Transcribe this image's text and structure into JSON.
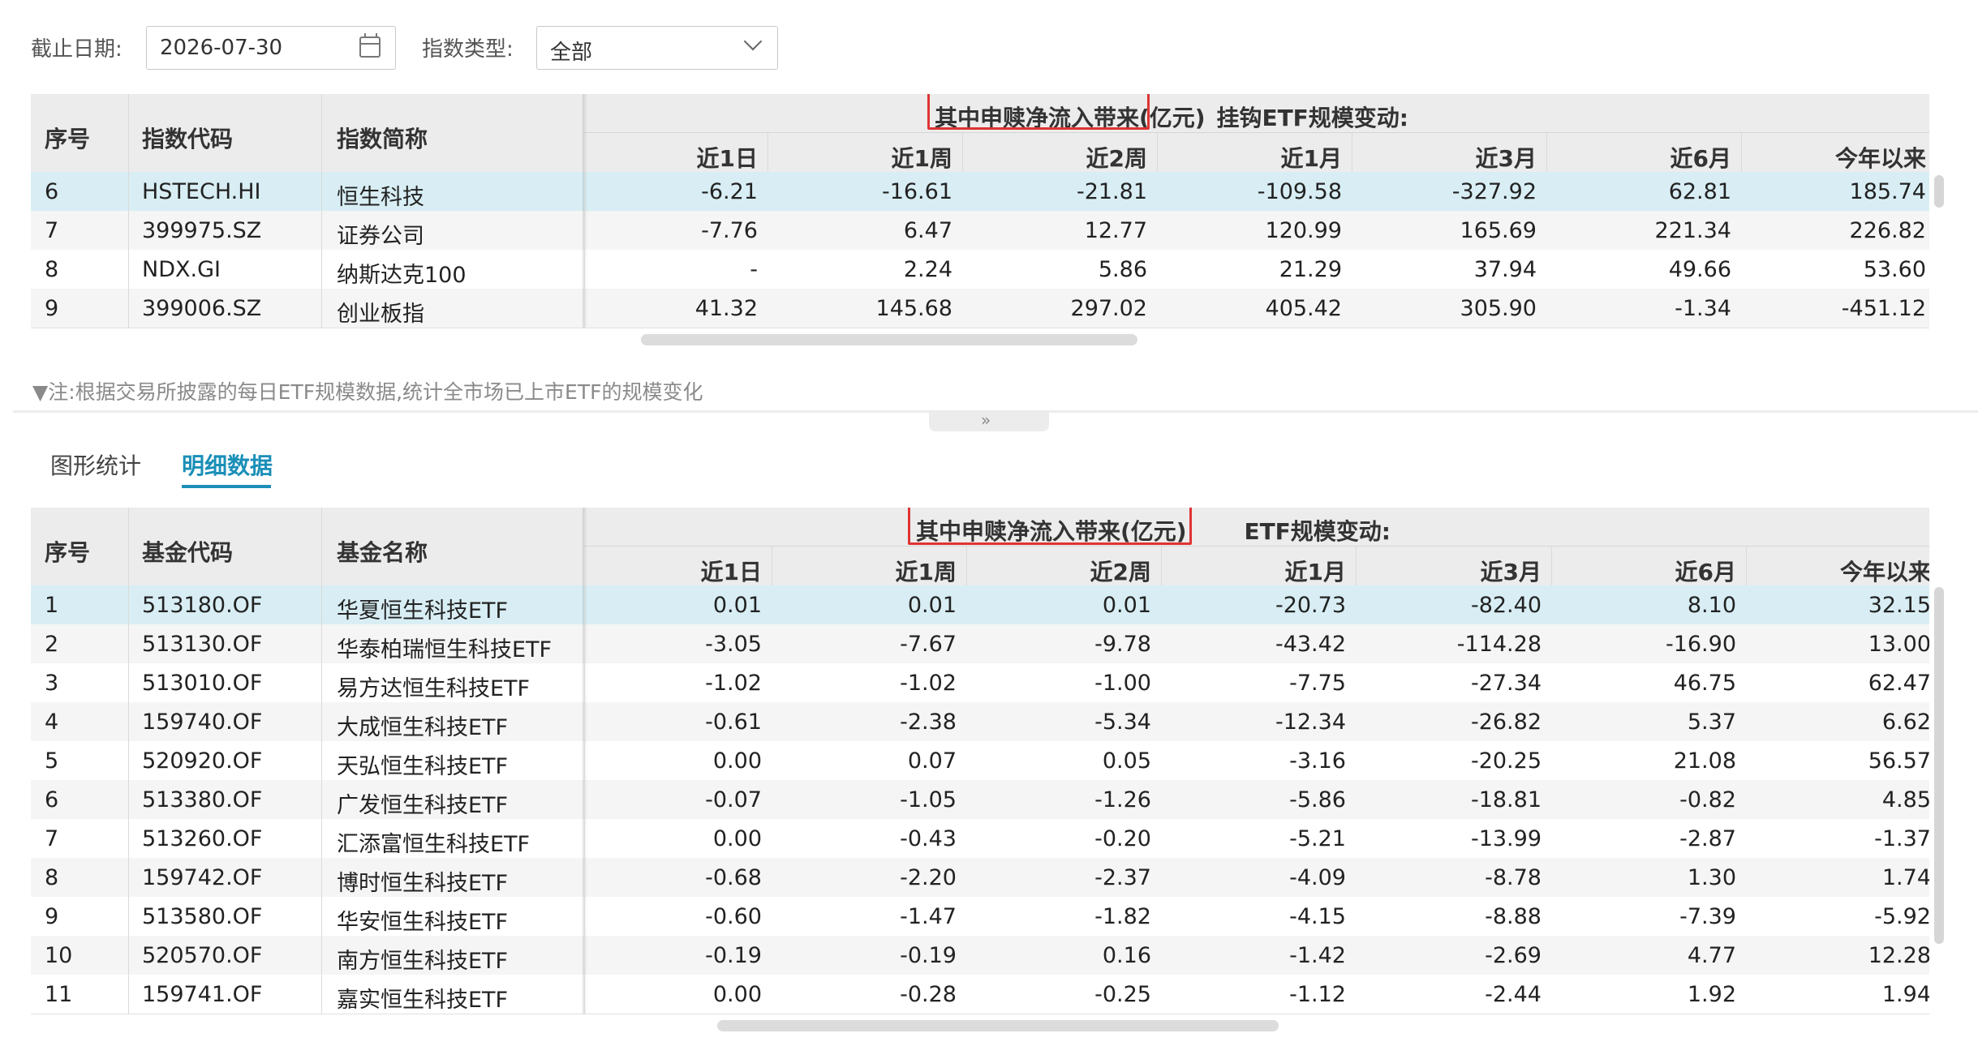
{
  "filters": {
    "date_label": "截止日期:",
    "date_value": "2026-07-30",
    "type_label": "指数类型:",
    "type_value": "全部"
  },
  "index_table": {
    "group_prefix": "挂钩ETF规模变动:",
    "group_highlight": "其中申赎净流入带来(亿元)",
    "fixed_headers": [
      "序号",
      "指数代码",
      "指数简称"
    ],
    "period_headers": [
      "近1日",
      "近1周",
      "近2周",
      "近1月",
      "近3月",
      "近6月",
      "今年以来"
    ],
    "rows": [
      {
        "no": "6",
        "code": "HSTECH.HI",
        "name": "恒生科技",
        "v": [
          "-6.21",
          "-16.61",
          "-21.81",
          "-109.58",
          "-327.92",
          "62.81",
          "185.74"
        ]
      },
      {
        "no": "7",
        "code": "399975.SZ",
        "name": "证券公司",
        "v": [
          "-7.76",
          "6.47",
          "12.77",
          "120.99",
          "165.69",
          "221.34",
          "226.82"
        ]
      },
      {
        "no": "8",
        "code": "NDX.GI",
        "name": "纳斯达克100",
        "v": [
          "-",
          "2.24",
          "5.86",
          "21.29",
          "37.94",
          "49.66",
          "53.60"
        ]
      },
      {
        "no": "9",
        "code": "399006.SZ",
        "name": "创业板指",
        "v": [
          "41.32",
          "145.68",
          "297.02",
          "405.42",
          "305.90",
          "-1.34",
          "-451.12"
        ]
      }
    ]
  },
  "note": "▼注:根据交易所披露的每日ETF规模数据,统计全市场已上市ETF的规模变化",
  "tabs": [
    "图形统计",
    "明细数据"
  ],
  "fund_table": {
    "group_prefix": "ETF规模变动:",
    "group_highlight": "其中申赎净流入带来(亿元)",
    "fixed_headers": [
      "序号",
      "基金代码",
      "基金名称"
    ],
    "period_headers": [
      "近1日",
      "近1周",
      "近2周",
      "近1月",
      "近3月",
      "近6月",
      "今年以来"
    ],
    "rows": [
      {
        "no": "1",
        "code": "513180.OF",
        "name": "华夏恒生科技ETF",
        "v": [
          "0.01",
          "0.01",
          "0.01",
          "-20.73",
          "-82.40",
          "8.10",
          "32.15"
        ]
      },
      {
        "no": "2",
        "code": "513130.OF",
        "name": "华泰柏瑞恒生科技ETF",
        "v": [
          "-3.05",
          "-7.67",
          "-9.78",
          "-43.42",
          "-114.28",
          "-16.90",
          "13.00"
        ]
      },
      {
        "no": "3",
        "code": "513010.OF",
        "name": "易方达恒生科技ETF",
        "v": [
          "-1.02",
          "-1.02",
          "-1.00",
          "-7.75",
          "-27.34",
          "46.75",
          "62.47"
        ]
      },
      {
        "no": "4",
        "code": "159740.OF",
        "name": "大成恒生科技ETF",
        "v": [
          "-0.61",
          "-2.38",
          "-5.34",
          "-12.34",
          "-26.82",
          "5.37",
          "6.62"
        ]
      },
      {
        "no": "5",
        "code": "520920.OF",
        "name": "天弘恒生科技ETF",
        "v": [
          "0.00",
          "0.07",
          "0.05",
          "-3.16",
          "-20.25",
          "21.08",
          "56.57"
        ]
      },
      {
        "no": "6",
        "code": "513380.OF",
        "name": "广发恒生科技ETF",
        "v": [
          "-0.07",
          "-1.05",
          "-1.26",
          "-5.86",
          "-18.81",
          "-0.82",
          "4.85"
        ]
      },
      {
        "no": "7",
        "code": "513260.OF",
        "name": "汇添富恒生科技ETF",
        "v": [
          "0.00",
          "-0.43",
          "-0.20",
          "-5.21",
          "-13.99",
          "-2.87",
          "-1.37"
        ]
      },
      {
        "no": "8",
        "code": "159742.OF",
        "name": "博时恒生科技ETF",
        "v": [
          "-0.68",
          "-2.20",
          "-2.37",
          "-4.09",
          "-8.78",
          "1.30",
          "1.74"
        ]
      },
      {
        "no": "9",
        "code": "513580.OF",
        "name": "华安恒生科技ETF",
        "v": [
          "-0.60",
          "-1.47",
          "-1.82",
          "-4.15",
          "-8.88",
          "-7.39",
          "-5.92"
        ]
      },
      {
        "no": "10",
        "code": "520570.OF",
        "name": "南方恒生科技ETF",
        "v": [
          "-0.19",
          "-0.19",
          "0.16",
          "-1.42",
          "-2.69",
          "4.77",
          "12.28"
        ]
      },
      {
        "no": "11",
        "code": "159741.OF",
        "name": "嘉实恒生科技ETF",
        "v": [
          "0.00",
          "-0.28",
          "-0.25",
          "-1.12",
          "-2.44",
          "1.92",
          "1.94"
        ]
      }
    ]
  }
}
